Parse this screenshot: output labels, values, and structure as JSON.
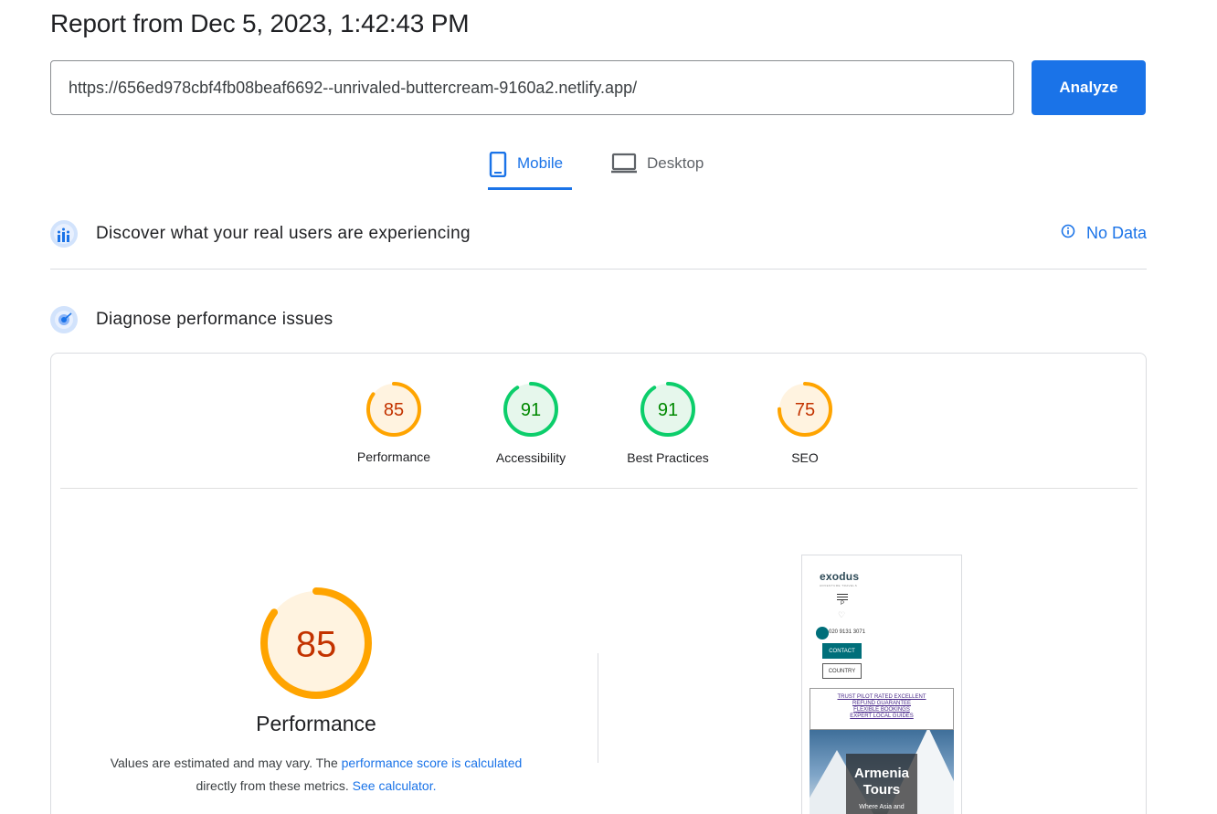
{
  "report": {
    "title": "Report from Dec 5, 2023, 1:42:43 PM"
  },
  "url_bar": {
    "value": "https://656ed978cbf4fb08beaf6692--unrivaled-buttercream-9160a2.netlify.app/",
    "button_label": "Analyze"
  },
  "tabs": [
    {
      "label": "Mobile",
      "selected": true,
      "icon": "smartphone-icon"
    },
    {
      "label": "Desktop",
      "selected": false,
      "icon": "laptop-icon"
    }
  ],
  "sections": {
    "real_users": {
      "title": "Discover what your real users are experiencing",
      "status": "No Data",
      "icon": "crux-people-icon"
    },
    "diagnose": {
      "title": "Diagnose performance issues",
      "icon": "lighthouse-icon"
    }
  },
  "categories": [
    {
      "label": "Performance",
      "score": 85,
      "rating": "average"
    },
    {
      "label": "Accessibility",
      "score": 91,
      "rating": "pass"
    },
    {
      "label": "Best Practices",
      "score": 91,
      "rating": "pass"
    },
    {
      "label": "SEO",
      "score": 75,
      "rating": "average"
    }
  ],
  "main_gauge": {
    "label": "Performance",
    "score": 85
  },
  "note": {
    "text1": "Values are estimated and may vary. The ",
    "link1": "performance score is calculated",
    "text2": "directly from these metrics. ",
    "link2": "See calculator."
  },
  "colors": {
    "average_stroke": "#ffa400",
    "average_text": "#c33300",
    "average_fill": "#fff3e0",
    "pass_stroke": "#0cce6b",
    "pass_text": "#008800",
    "pass_fill": "#e6f7ec",
    "accent": "#1a73e8"
  },
  "screenshot": {
    "logo": "exodus",
    "logo_sub": "ADVENTURE TRAVELS",
    "p_char": "P",
    "phone": "020 9131 3071",
    "contact": "CONTACT",
    "country": "COUNTRY",
    "promo": [
      "TRUST PILOT RATED EXCELLENT",
      "REFUND GUARANTEE",
      "FLEXIBLE BOOKINGS",
      "EXPERT LOCAL GUIDES"
    ],
    "hero_title_1": "Armenia",
    "hero_title_2": "Tours",
    "hero_sub": "Where Asia and"
  }
}
